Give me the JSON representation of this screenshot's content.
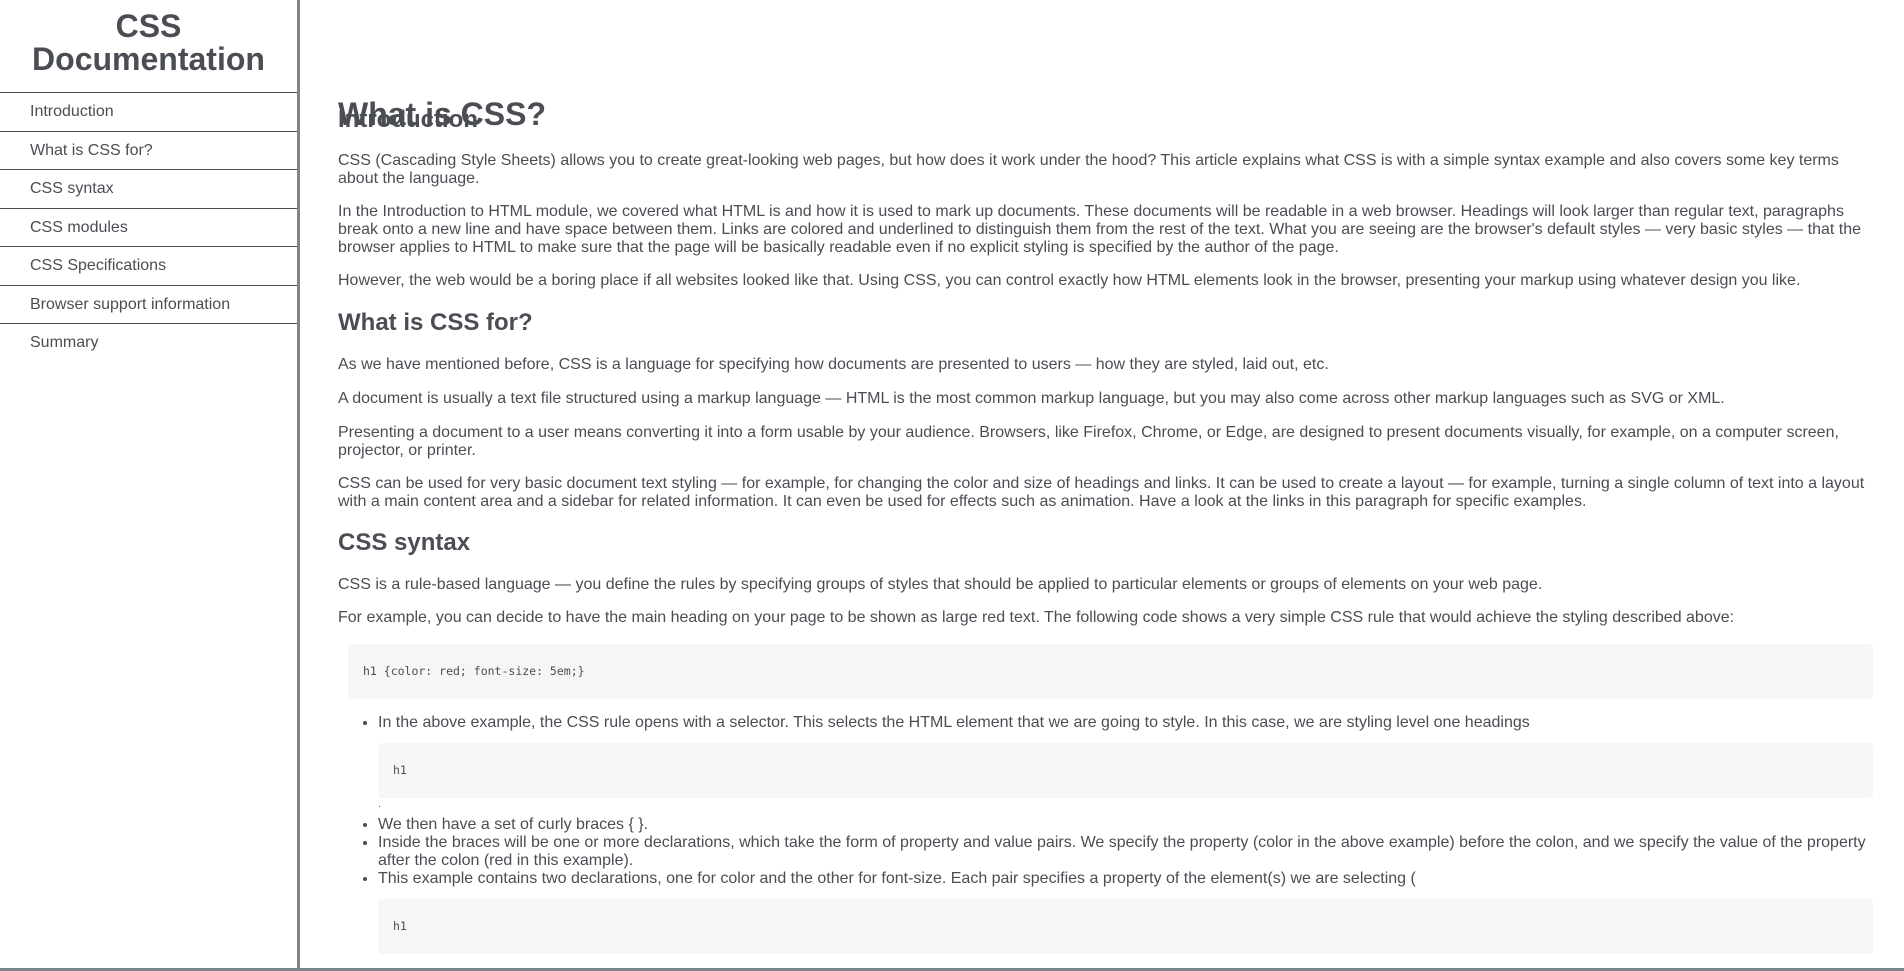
{
  "nav": {
    "title": "CSS Documentation",
    "items": [
      {
        "label": "Introduction"
      },
      {
        "label": "What is CSS for?"
      },
      {
        "label": "CSS syntax"
      },
      {
        "label": "CSS modules"
      },
      {
        "label": "CSS Specifications"
      },
      {
        "label": "Browser support information"
      },
      {
        "label": "Summary"
      }
    ]
  },
  "main": {
    "page_title": "What is CSS?",
    "sections": {
      "introduction": {
        "title": "Introduction",
        "p1": "CSS (Cascading Style Sheets) allows you to create great-looking web pages, but how does it work under the hood? This article explains what CSS is with a simple syntax example and also covers some key terms about the language.",
        "p2": "In the Introduction to HTML module, we covered what HTML is and how it is used to mark up documents. These documents will be readable in a web browser. Headings will look larger than regular text, paragraphs break onto a new line and have space between them. Links are colored and underlined to distinguish them from the rest of the text. What you are seeing are the browser's default styles — very basic styles — that the browser applies to HTML to make sure that the page will be basically readable even if no explicit styling is specified by the author of the page.",
        "p3": "However, the web would be a boring place if all websites looked like that. Using CSS, you can control exactly how HTML elements look in the browser, presenting your markup using whatever design you like."
      },
      "what_for": {
        "title": "What is CSS for?",
        "p1": "As we have mentioned before, CSS is a language for specifying how documents are presented to users — how they are styled, laid out, etc.",
        "p2": "A document is usually a text file structured using a markup language — HTML is the most common markup language, but you may also come across other markup languages such as SVG or XML.",
        "p3": "Presenting a document to a user means converting it into a form usable by your audience. Browsers, like Firefox, Chrome, or Edge, are designed to present documents visually, for example, on a computer screen, projector, or printer.",
        "p4": "CSS can be used for very basic document text styling — for example, for changing the color and size of headings and links. It can be used to create a layout — for example, turning a single column of text into a layout with a main content area and a sidebar for related information. It can even be used for effects such as animation. Have a look at the links in this paragraph for specific examples."
      },
      "syntax": {
        "title": "CSS syntax",
        "p1": "CSS is a rule-based language — you define the rules by specifying groups of styles that should be applied to particular elements or groups of elements on your web page.",
        "p2": "For example, you can decide to have the main heading on your page to be shown as large red text. The following code shows a very simple CSS rule that would achieve the styling described above:",
        "code1": "h1 {color: red; font-size: 5em;}",
        "bullet1": "In the above example, the CSS rule opens with a selector. This selects the HTML element that we are going to style. In this case, we are styling level one headings",
        "code2": "h1",
        "stray": ".",
        "bullet2": "We then have a set of curly braces { }.",
        "bullet3": "Inside the braces will be one or more declarations, which take the form of property and value pairs. We specify the property (color in the above example) before the colon, and we specify the value of the property after the colon (red in this example).",
        "bullet4": "This example contains two declarations, one for color and the other for font-size. Each pair specifies a property of the element(s) we are selecting (",
        "code3": "h1"
      }
    }
  }
}
